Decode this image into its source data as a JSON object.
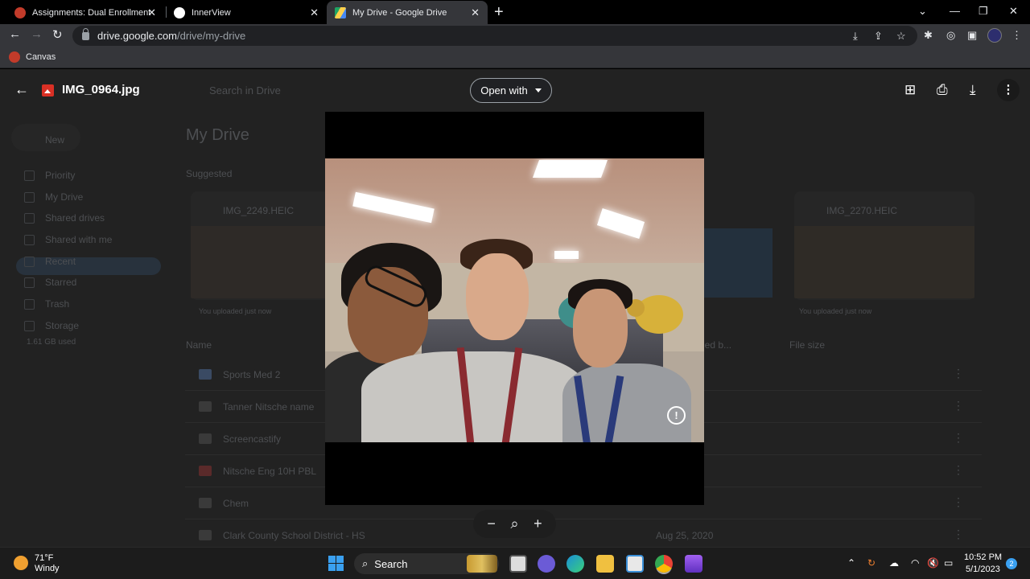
{
  "tabs": [
    {
      "title": "Assignments: Dual Enrollment - E",
      "active": false
    },
    {
      "title": "InnerView",
      "active": false
    },
    {
      "title": "My Drive - Google Drive",
      "active": true
    }
  ],
  "address": {
    "host": "drive.google.com",
    "path": "/drive/my-drive"
  },
  "bookmarks": [
    {
      "label": "Canvas"
    }
  ],
  "viewer": {
    "file_name": "IMG_0964.jpg",
    "open_with_label": "Open with"
  },
  "drive_bg": {
    "search_placeholder": "Search in Drive",
    "new_label": "New",
    "title": "My Drive",
    "suggested_label": "Suggested",
    "sidebar": [
      "Priority",
      "My Drive",
      "Shared drives",
      "Shared with me",
      "Recent",
      "Starred",
      "Trash",
      "Storage"
    ],
    "storage_used": "1.61 GB used",
    "cards": [
      {
        "name": "IMG_2249.HEIC",
        "caption": "You uploaded just now"
      },
      {
        "name": "IMG_2270.HEIC",
        "caption": "You uploaded just now"
      }
    ],
    "col_name": "Name",
    "col_size": "File size",
    "col_mod": "ied b...",
    "rows": [
      {
        "name": "Sports Med 2",
        "date": ""
      },
      {
        "name": "Tanner Nitsche name",
        "date": ""
      },
      {
        "name": "Screencastify",
        "date": ""
      },
      {
        "name": "Nitsche Eng 10H PBL",
        "date": ""
      },
      {
        "name": "Chem",
        "date": ""
      },
      {
        "name": "Clark County School District - HS",
        "date": "Aug 25, 2020"
      }
    ]
  },
  "taskbar": {
    "temp": "71°F",
    "weather": "Windy",
    "search_label": "Search",
    "time": "10:52 PM",
    "date": "5/1/2023",
    "notifications": "2"
  },
  "colors": {
    "accent": "#8ab4f8",
    "file_icon": "#d93025",
    "start": "#3aa0f0"
  }
}
